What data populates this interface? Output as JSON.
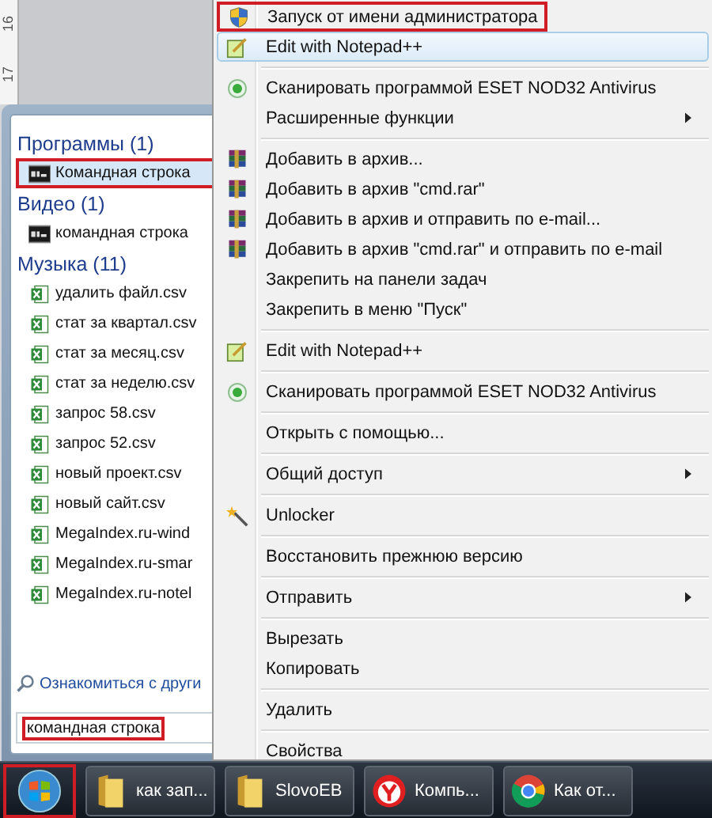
{
  "ruler": {
    "labels": [
      "16",
      "17"
    ]
  },
  "start_menu": {
    "groups": [
      {
        "title": "Программы (1)",
        "items": [
          {
            "label": "Командная строка",
            "kind": "console",
            "selected": true,
            "outlined": true
          }
        ]
      },
      {
        "title": "Видео (1)",
        "items": [
          {
            "label": "командная строка",
            "kind": "console",
            "selected": false,
            "outlined": false
          }
        ]
      },
      {
        "title": "Музыка (11)",
        "items": [
          {
            "label": "удалить файл.csv",
            "kind": "spreadsheet",
            "selected": false,
            "outlined": false
          },
          {
            "label": "стат за квартал.csv",
            "kind": "spreadsheet",
            "selected": false,
            "outlined": false
          },
          {
            "label": "стат за месяц.csv",
            "kind": "spreadsheet",
            "selected": false,
            "outlined": false
          },
          {
            "label": "стат за неделю.csv",
            "kind": "spreadsheet",
            "selected": false,
            "outlined": false
          },
          {
            "label": "запрос 58.csv",
            "kind": "spreadsheet",
            "selected": false,
            "outlined": false
          },
          {
            "label": "запрос 52.csv",
            "kind": "spreadsheet",
            "selected": false,
            "outlined": false
          },
          {
            "label": "новый проект.csv",
            "kind": "spreadsheet",
            "selected": false,
            "outlined": false
          },
          {
            "label": "новый сайт.csv",
            "kind": "spreadsheet",
            "selected": false,
            "outlined": false
          },
          {
            "label": "MegaIndex.ru-wind",
            "kind": "spreadsheet",
            "selected": false,
            "outlined": false
          },
          {
            "label": "MegaIndex.ru-smar",
            "kind": "spreadsheet",
            "selected": false,
            "outlined": false
          },
          {
            "label": "MegaIndex.ru-notel",
            "kind": "spreadsheet",
            "selected": false,
            "outlined": false
          }
        ]
      }
    ],
    "link": "Ознакомиться с други",
    "search": {
      "value": "командная строка",
      "outlined": true
    }
  },
  "context_menu": {
    "items": [
      {
        "kind": "shield",
        "label": "Запуск от имени администратора",
        "submenu": false,
        "highlighted": false,
        "outlined": true
      },
      {
        "kind": "notepad",
        "label": "Edit with Notepad++",
        "submenu": false,
        "highlighted": true,
        "outlined": false
      },
      {
        "kind": "separator"
      },
      {
        "kind": "scan",
        "label": "Сканировать программой ESET NOD32 Antivirus",
        "submenu": false,
        "highlighted": false,
        "outlined": false
      },
      {
        "kind": "plain",
        "label": "Расширенные функции",
        "submenu": true,
        "highlighted": false,
        "outlined": false
      },
      {
        "kind": "separator"
      },
      {
        "kind": "archive",
        "label": "Добавить в архив...",
        "submenu": false,
        "highlighted": false,
        "outlined": false
      },
      {
        "kind": "archive",
        "label": "Добавить в архив \"cmd.rar\"",
        "submenu": false,
        "highlighted": false,
        "outlined": false
      },
      {
        "kind": "archive",
        "label": "Добавить в архив и отправить по e-mail...",
        "submenu": false,
        "highlighted": false,
        "outlined": false
      },
      {
        "kind": "archive",
        "label": "Добавить в архив \"cmd.rar\" и отправить по e-mail",
        "submenu": false,
        "highlighted": false,
        "outlined": false
      },
      {
        "kind": "plain",
        "label": "Закрепить на панели задач",
        "submenu": false,
        "highlighted": false,
        "outlined": false
      },
      {
        "kind": "plain",
        "label": "Закрепить в меню \"Пуск\"",
        "submenu": false,
        "highlighted": false,
        "outlined": false
      },
      {
        "kind": "separator"
      },
      {
        "kind": "notepad",
        "label": "Edit with Notepad++",
        "submenu": false,
        "highlighted": false,
        "outlined": false
      },
      {
        "kind": "separator"
      },
      {
        "kind": "scan",
        "label": "Сканировать программой ESET NOD32 Antivirus",
        "submenu": false,
        "highlighted": false,
        "outlined": false
      },
      {
        "kind": "separator"
      },
      {
        "kind": "plain",
        "label": "Открыть с помощью...",
        "submenu": false,
        "highlighted": false,
        "outlined": false
      },
      {
        "kind": "separator"
      },
      {
        "kind": "plain",
        "label": "Общий доступ",
        "submenu": true,
        "highlighted": false,
        "outlined": false
      },
      {
        "kind": "separator"
      },
      {
        "kind": "unlocker",
        "label": "Unlocker",
        "submenu": false,
        "highlighted": false,
        "outlined": false
      },
      {
        "kind": "separator"
      },
      {
        "kind": "plain",
        "label": "Восстановить прежнюю версию",
        "submenu": false,
        "highlighted": false,
        "outlined": false
      },
      {
        "kind": "separator"
      },
      {
        "kind": "plain",
        "label": "Отправить",
        "submenu": true,
        "highlighted": false,
        "outlined": false
      },
      {
        "kind": "separator"
      },
      {
        "kind": "plain",
        "label": "Вырезать",
        "submenu": false,
        "highlighted": false,
        "outlined": false
      },
      {
        "kind": "plain",
        "label": "Копировать",
        "submenu": false,
        "highlighted": false,
        "outlined": false
      },
      {
        "kind": "separator"
      },
      {
        "kind": "plain",
        "label": "Удалить",
        "submenu": false,
        "highlighted": false,
        "outlined": false
      },
      {
        "kind": "separator"
      },
      {
        "kind": "plain",
        "label": "Свойства",
        "submenu": false,
        "highlighted": false,
        "outlined": false
      }
    ]
  },
  "taskbar": {
    "start_button": {
      "outlined": true
    },
    "buttons": [
      {
        "label": "как зап...",
        "kind": "folder"
      },
      {
        "label": "SlovoEB",
        "kind": "folder"
      },
      {
        "label": "Компь...",
        "kind": "yandex"
      },
      {
        "label": "Как от...",
        "kind": "chrome"
      }
    ]
  }
}
